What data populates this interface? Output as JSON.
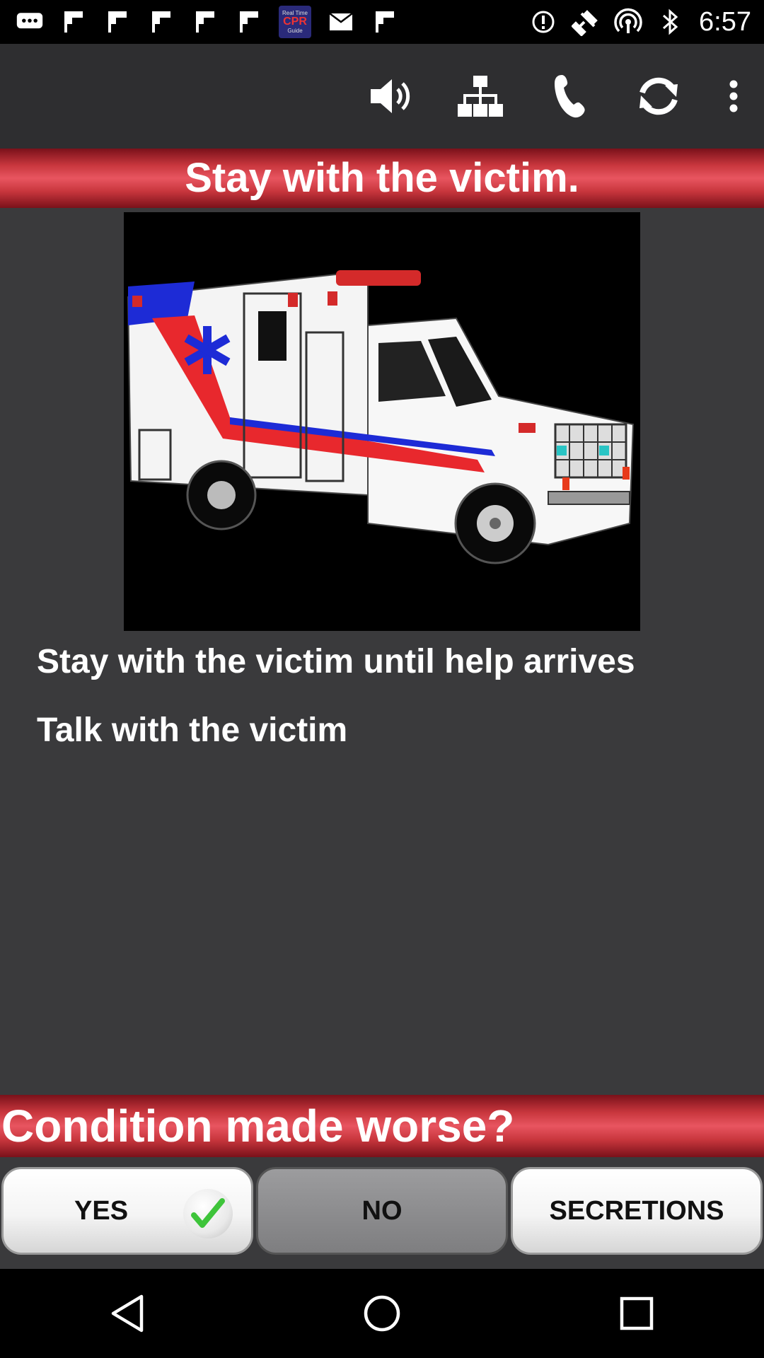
{
  "status_bar": {
    "time": "6:57",
    "left_icons": [
      "messages-icon",
      "flipboard-icon",
      "flipboard-icon",
      "flipboard-icon",
      "flipboard-icon",
      "flipboard-icon",
      "cpr-guide-app-icon",
      "email-icon",
      "flipboard-icon",
      "alert-icon",
      "fake-gps-icon",
      "hotspot-icon",
      "bluetooth-icon"
    ],
    "cpr_badge": {
      "top": "Real Time",
      "main": "CPR",
      "bottom": "Guide"
    }
  },
  "app_bar": {
    "actions": [
      "volume-icon",
      "network-tree-icon",
      "phone-icon",
      "refresh-icon",
      "more-vert-icon"
    ]
  },
  "title": "Stay with the victim.",
  "instructions": [
    "Stay with the victim until help arrives",
    "Talk with the victim"
  ],
  "question": "Condition made worse?",
  "buttons": {
    "yes": "YES",
    "no": "NO",
    "secretions": "SECRETIONS"
  },
  "nav": [
    "back-icon",
    "home-icon",
    "recents-icon"
  ],
  "colors": {
    "banner_red": "#c8363d",
    "content_bg": "#3a3a3c",
    "appbar_bg": "#2e2e30"
  }
}
